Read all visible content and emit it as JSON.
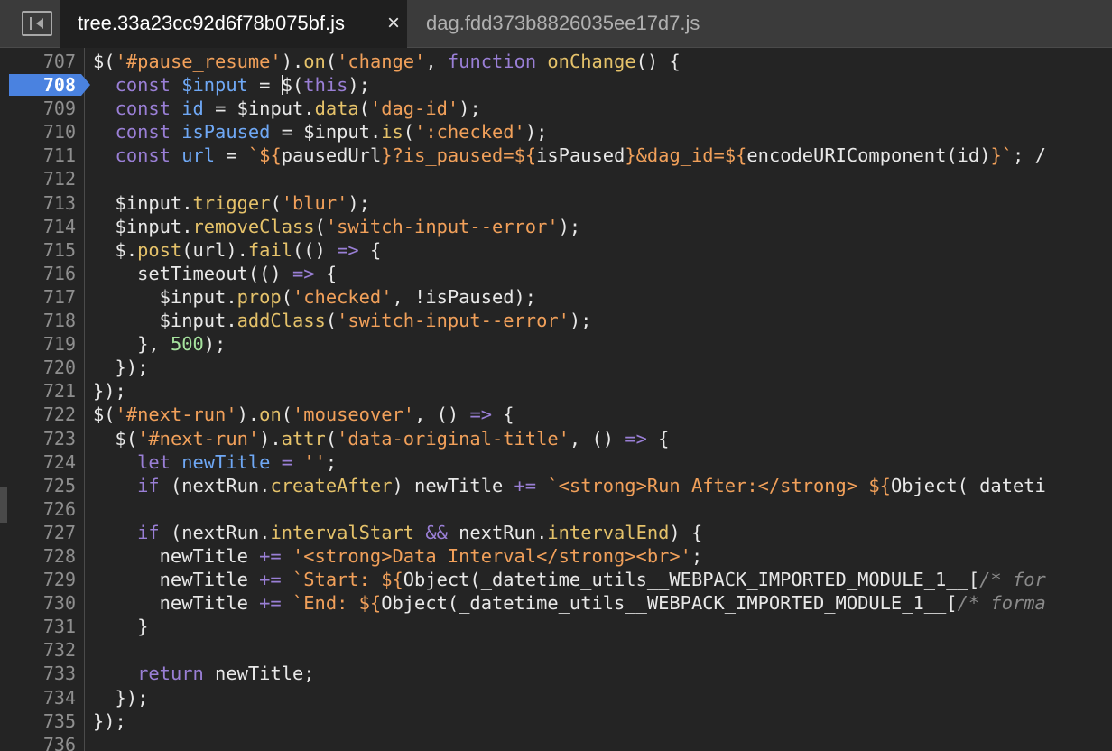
{
  "tabs": [
    {
      "label": "tree.33a23cc92d6f78b075bf.js",
      "close": "×",
      "active": true
    },
    {
      "label": "dag.fdd373b8826035ee17d7.js",
      "active": false
    }
  ],
  "editor": {
    "breakpoint_line": "708",
    "lines": [
      {
        "num": "707",
        "tokens": [
          [
            "",
            "$("
          ],
          [
            "s",
            "'#pause_resume'"
          ],
          [
            "",
            ")."
          ],
          [
            "f",
            "on"
          ],
          [
            "",
            "("
          ],
          [
            "s",
            "'change'"
          ],
          [
            "",
            ", "
          ],
          [
            "k",
            "function"
          ],
          [
            "f",
            " onChange"
          ],
          [
            "",
            "() {"
          ]
        ]
      },
      {
        "num": "708",
        "tokens": [
          [
            "",
            "  "
          ],
          [
            "k",
            "const"
          ],
          [
            "p",
            " $input"
          ],
          [
            "",
            " = "
          ],
          [
            "caret",
            ""
          ],
          [
            "",
            "$("
          ],
          [
            "k",
            "this"
          ],
          [
            "",
            ");"
          ]
        ]
      },
      {
        "num": "709",
        "tokens": [
          [
            "",
            "  "
          ],
          [
            "k",
            "const"
          ],
          [
            "p",
            " id"
          ],
          [
            "",
            " = $input."
          ],
          [
            "f",
            "data"
          ],
          [
            "",
            "("
          ],
          [
            "s",
            "'dag-id'"
          ],
          [
            "",
            ");"
          ]
        ]
      },
      {
        "num": "710",
        "tokens": [
          [
            "",
            "  "
          ],
          [
            "k",
            "const"
          ],
          [
            "p",
            " isPaused"
          ],
          [
            "",
            " = $input."
          ],
          [
            "f",
            "is"
          ],
          [
            "",
            "("
          ],
          [
            "s",
            "':checked'"
          ],
          [
            "",
            ");"
          ]
        ]
      },
      {
        "num": "711",
        "tokens": [
          [
            "",
            "  "
          ],
          [
            "k",
            "const"
          ],
          [
            "p",
            " url"
          ],
          [
            "",
            " = "
          ],
          [
            "s",
            "`${"
          ],
          [
            "",
            "pausedUrl"
          ],
          [
            "s",
            "}?is_paused=${"
          ],
          [
            "",
            "isPaused"
          ],
          [
            "s",
            "}&dag_id=${"
          ],
          [
            "",
            "encodeURIComponent(id)"
          ],
          [
            "s",
            "}`"
          ],
          [
            "",
            "; /"
          ]
        ]
      },
      {
        "num": "712",
        "tokens": []
      },
      {
        "num": "713",
        "tokens": [
          [
            "",
            "  $input."
          ],
          [
            "f",
            "trigger"
          ],
          [
            "",
            "("
          ],
          [
            "s",
            "'blur'"
          ],
          [
            "",
            ");"
          ]
        ]
      },
      {
        "num": "714",
        "tokens": [
          [
            "",
            "  $input."
          ],
          [
            "f",
            "removeClass"
          ],
          [
            "",
            "("
          ],
          [
            "s",
            "'switch-input--error'"
          ],
          [
            "",
            ");"
          ]
        ]
      },
      {
        "num": "715",
        "tokens": [
          [
            "",
            "  $."
          ],
          [
            "f",
            "post"
          ],
          [
            "",
            "(url)."
          ],
          [
            "f",
            "fail"
          ],
          [
            "",
            "(() "
          ],
          [
            "k",
            "=>"
          ],
          [
            "",
            " {"
          ]
        ]
      },
      {
        "num": "716",
        "tokens": [
          [
            "",
            "    setTimeout(() "
          ],
          [
            "k",
            "=>"
          ],
          [
            "",
            " {"
          ]
        ]
      },
      {
        "num": "717",
        "tokens": [
          [
            "",
            "      $input."
          ],
          [
            "f",
            "prop"
          ],
          [
            "",
            "("
          ],
          [
            "s",
            "'checked'"
          ],
          [
            "",
            ", !isPaused);"
          ]
        ]
      },
      {
        "num": "718",
        "tokens": [
          [
            "",
            "      $input."
          ],
          [
            "f",
            "addClass"
          ],
          [
            "",
            "("
          ],
          [
            "s",
            "'switch-input--error'"
          ],
          [
            "",
            ");"
          ]
        ]
      },
      {
        "num": "719",
        "tokens": [
          [
            "",
            "    }, "
          ],
          [
            "n",
            "500"
          ],
          [
            "",
            ");"
          ]
        ]
      },
      {
        "num": "720",
        "tokens": [
          [
            "",
            "  });"
          ]
        ]
      },
      {
        "num": "721",
        "tokens": [
          [
            "",
            "});"
          ]
        ]
      },
      {
        "num": "722",
        "tokens": [
          [
            "",
            "$("
          ],
          [
            "s",
            "'#next-run'"
          ],
          [
            "",
            ")."
          ],
          [
            "f",
            "on"
          ],
          [
            "",
            "("
          ],
          [
            "s",
            "'mouseover'"
          ],
          [
            "",
            ", () "
          ],
          [
            "k",
            "=>"
          ],
          [
            "",
            " {"
          ]
        ]
      },
      {
        "num": "723",
        "tokens": [
          [
            "",
            "  $("
          ],
          [
            "s",
            "'#next-run'"
          ],
          [
            "",
            ")."
          ],
          [
            "f",
            "attr"
          ],
          [
            "",
            "("
          ],
          [
            "s",
            "'data-original-title'"
          ],
          [
            "",
            ", () "
          ],
          [
            "k",
            "=>"
          ],
          [
            "",
            " {"
          ]
        ]
      },
      {
        "num": "724",
        "tokens": [
          [
            "",
            "    "
          ],
          [
            "k",
            "let"
          ],
          [
            "p",
            " newTitle"
          ],
          [
            "k",
            " ="
          ],
          [
            "",
            " "
          ],
          [
            "s",
            "''"
          ],
          [
            "",
            ";"
          ]
        ]
      },
      {
        "num": "725",
        "tokens": [
          [
            "",
            "    "
          ],
          [
            "k",
            "if"
          ],
          [
            "",
            " (nextRun."
          ],
          [
            "f",
            "createAfter"
          ],
          [
            "",
            ") newTitle "
          ],
          [
            "k",
            "+="
          ],
          [
            "",
            " "
          ],
          [
            "s",
            "`<strong>Run After:</strong> ${"
          ],
          [
            "",
            "Object(_dateti"
          ]
        ]
      },
      {
        "num": "726",
        "tokens": []
      },
      {
        "num": "727",
        "tokens": [
          [
            "",
            "    "
          ],
          [
            "k",
            "if"
          ],
          [
            "",
            " (nextRun."
          ],
          [
            "f",
            "intervalStart"
          ],
          [
            "",
            " "
          ],
          [
            "k",
            "&&"
          ],
          [
            "",
            " nextRun."
          ],
          [
            "f",
            "intervalEnd"
          ],
          [
            "",
            ") {"
          ]
        ]
      },
      {
        "num": "728",
        "tokens": [
          [
            "",
            "      newTitle "
          ],
          [
            "k",
            "+="
          ],
          [
            "",
            " "
          ],
          [
            "s",
            "'<strong>Data Interval</strong><br>'"
          ],
          [
            "",
            ";"
          ]
        ]
      },
      {
        "num": "729",
        "tokens": [
          [
            "",
            "      newTitle "
          ],
          [
            "k",
            "+="
          ],
          [
            "",
            " "
          ],
          [
            "s",
            "`Start: ${"
          ],
          [
            "",
            "Object(_datetime_utils__WEBPACK_IMPORTED_MODULE_1__["
          ],
          [
            "c",
            "/* for"
          ]
        ]
      },
      {
        "num": "730",
        "tokens": [
          [
            "",
            "      newTitle "
          ],
          [
            "k",
            "+="
          ],
          [
            "",
            " "
          ],
          [
            "s",
            "`End: ${"
          ],
          [
            "",
            "Object(_datetime_utils__WEBPACK_IMPORTED_MODULE_1__["
          ],
          [
            "c",
            "/* forma"
          ]
        ]
      },
      {
        "num": "731",
        "tokens": [
          [
            "",
            "    }"
          ]
        ]
      },
      {
        "num": "732",
        "tokens": []
      },
      {
        "num": "733",
        "tokens": [
          [
            "",
            "    "
          ],
          [
            "k",
            "return"
          ],
          [
            "",
            " newTitle;"
          ]
        ]
      },
      {
        "num": "734",
        "tokens": [
          [
            "",
            "  });"
          ]
        ]
      },
      {
        "num": "735",
        "tokens": [
          [
            "",
            "});"
          ]
        ]
      },
      {
        "num": "736",
        "tokens": []
      }
    ]
  }
}
